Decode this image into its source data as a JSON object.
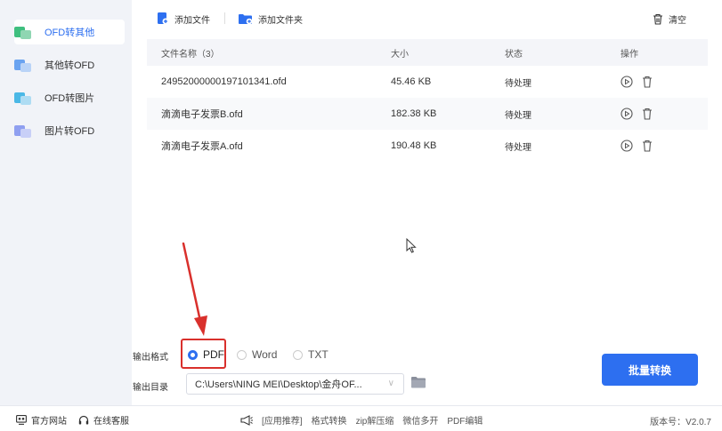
{
  "sidebar": {
    "items": [
      {
        "label": "OFD转其他",
        "active": true
      },
      {
        "label": "其他转OFD",
        "active": false
      },
      {
        "label": "OFD转图片",
        "active": false
      },
      {
        "label": "图片转OFD",
        "active": false
      }
    ]
  },
  "toolbar": {
    "add_file": "添加文件",
    "add_folder": "添加文件夹",
    "clear": "清空"
  },
  "table": {
    "headers": {
      "name": "文件名称（3）",
      "size": "大小",
      "status": "状态",
      "ops": "操作"
    },
    "rows": [
      {
        "name": "24952000000197101341.ofd",
        "size": "45.46 KB",
        "status": "待处理"
      },
      {
        "name": "滴滴电子发票B.ofd",
        "size": "182.38 KB",
        "status": "待处理"
      },
      {
        "name": "滴滴电子发票A.ofd",
        "size": "190.48 KB",
        "status": "待处理"
      }
    ]
  },
  "output": {
    "format_label": "输出格式",
    "formats": [
      "PDF",
      "Word",
      "TXT"
    ],
    "selected": "PDF",
    "dir_label": "输出目录",
    "dir_value": "C:\\Users\\NING MEI\\Desktop\\金舟OF..."
  },
  "convert_button": "批量转换",
  "footer": {
    "website": "官方网站",
    "support": "在线客服",
    "promo": [
      "[应用推荐]",
      "格式转换",
      "zip解压缩",
      "微信多开",
      "PDF编辑"
    ],
    "version": "版本号：V2.0.7"
  },
  "colors": {
    "accent": "#2d6ff0",
    "highlight": "#d9302c",
    "sidebar_bg": "#f1f3f8"
  }
}
